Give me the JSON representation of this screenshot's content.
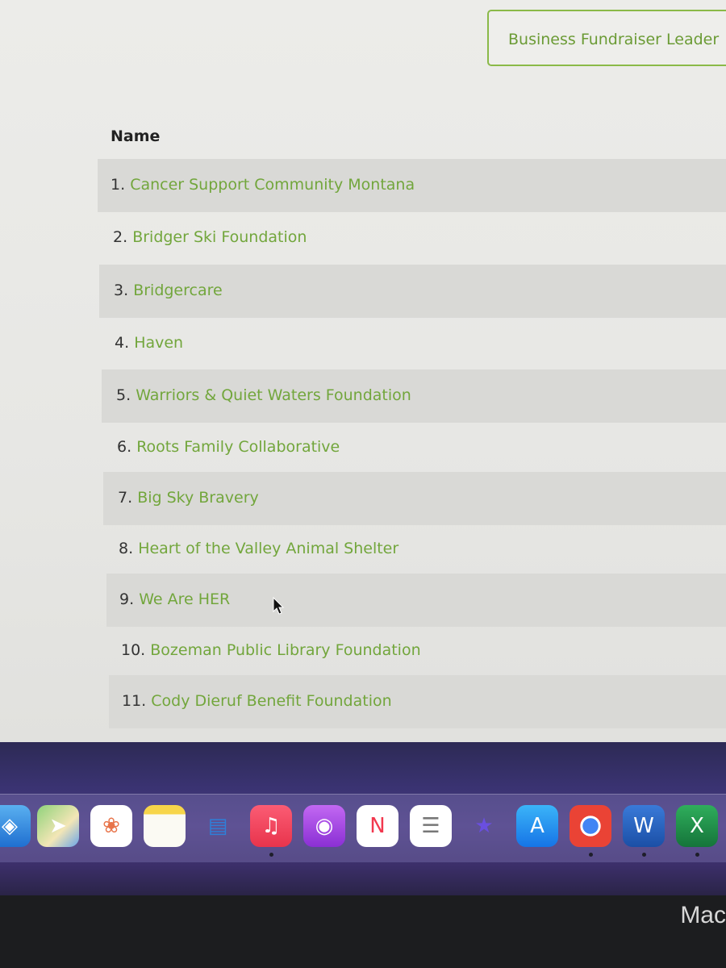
{
  "header": {
    "leaderboard_button": "Business Fundraiser Leader",
    "column_name": "Name"
  },
  "rows": [
    {
      "num": "1.",
      "name": "Cancer Support Community Montana"
    },
    {
      "num": "2.",
      "name": "Bridger Ski Foundation"
    },
    {
      "num": "3.",
      "name": "Bridgercare"
    },
    {
      "num": "4.",
      "name": "Haven"
    },
    {
      "num": "5.",
      "name": "Warriors & Quiet Waters Foundation"
    },
    {
      "num": "6.",
      "name": "Roots Family Collaborative"
    },
    {
      "num": "7.",
      "name": "Big Sky Bravery"
    },
    {
      "num": "8.",
      "name": "Heart of the Valley Animal Shelter"
    },
    {
      "num": "9.",
      "name": "We Are HER"
    },
    {
      "num": "10.",
      "name": "Bozeman Public Library Foundation"
    },
    {
      "num": "11.",
      "name": "Cody Dieruf Benefit Foundation"
    }
  ],
  "dock": {
    "apps": [
      {
        "icon": "safari-icon"
      },
      {
        "icon": "maps-icon"
      },
      {
        "icon": "photos-icon"
      },
      {
        "icon": "notes-icon"
      },
      {
        "icon": "keynote-icon"
      },
      {
        "icon": "music-icon",
        "running": true
      },
      {
        "icon": "podcasts-icon"
      },
      {
        "icon": "news-icon"
      },
      {
        "icon": "reminders-icon"
      },
      {
        "icon": "imovie-icon"
      },
      {
        "icon": "app-store-icon"
      },
      {
        "icon": "chrome-icon",
        "running": true
      },
      {
        "icon": "word-icon",
        "running": true
      },
      {
        "icon": "excel-icon",
        "running": true
      }
    ]
  },
  "bezel": {
    "label": "Mac"
  },
  "colors": {
    "link": "#72a63c",
    "accent_border": "#8ab948",
    "row_shade": "#d9d9d6"
  }
}
